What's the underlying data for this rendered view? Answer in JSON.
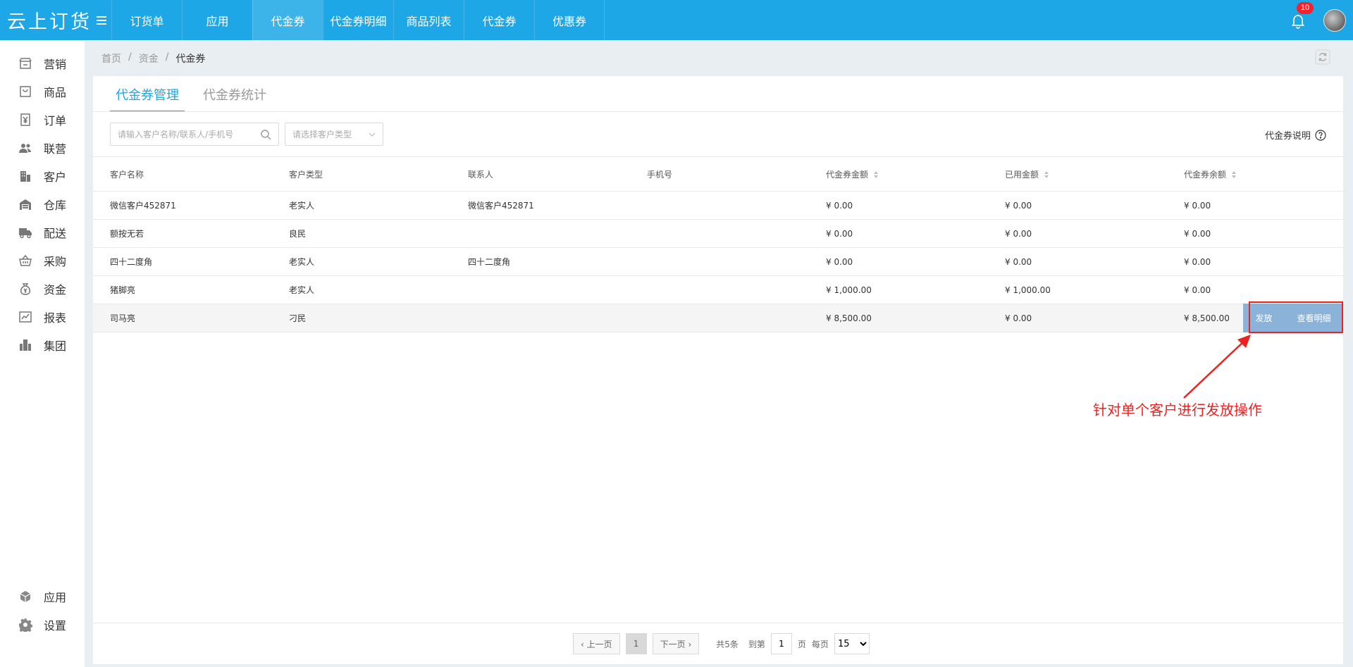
{
  "app": {
    "logo": "云上订货",
    "notification_count": "10"
  },
  "topnav": [
    {
      "label": "订货单",
      "active": false
    },
    {
      "label": "应用",
      "active": false
    },
    {
      "label": "代金券",
      "active": true
    },
    {
      "label": "代金券明细",
      "active": false
    },
    {
      "label": "商品列表",
      "active": false
    },
    {
      "label": "代金券",
      "active": false
    },
    {
      "label": "优惠券",
      "active": false
    }
  ],
  "sidebar": {
    "items": [
      {
        "label": "营销",
        "icon": "store-icon"
      },
      {
        "label": "商品",
        "icon": "shopping-bag-icon"
      },
      {
        "label": "订单",
        "icon": "yen-document-icon"
      },
      {
        "label": "联营",
        "icon": "users-icon"
      },
      {
        "label": "客户",
        "icon": "building-icon"
      },
      {
        "label": "仓库",
        "icon": "warehouse-icon"
      },
      {
        "label": "配送",
        "icon": "truck-icon"
      },
      {
        "label": "采购",
        "icon": "basket-icon"
      },
      {
        "label": "资金",
        "icon": "money-bag-icon"
      },
      {
        "label": "报表",
        "icon": "chart-icon"
      },
      {
        "label": "集团",
        "icon": "group-building-icon"
      }
    ],
    "bottom": [
      {
        "label": "应用",
        "icon": "cube-icon"
      },
      {
        "label": "设置",
        "icon": "gear-icon"
      }
    ]
  },
  "breadcrumb": {
    "home": "首页",
    "sep": "/",
    "parent": "资金",
    "current": "代金券"
  },
  "tabs": [
    {
      "label": "代金券管理",
      "active": true
    },
    {
      "label": "代金券统计",
      "active": false
    }
  ],
  "filters": {
    "search_placeholder": "请输入客户名称/联系人/手机号",
    "type_placeholder": "请选择客户类型",
    "help_label": "代金券说明"
  },
  "table": {
    "headers": [
      "客户名称",
      "客户类型",
      "联系人",
      "手机号",
      "代金券金额",
      "已用金额",
      "代金券余额"
    ],
    "rows": [
      {
        "name": "微信客户452871",
        "type": "老实人",
        "contact": "微信客户452871",
        "phone": "",
        "amount": "¥ 0.00",
        "used": "¥ 0.00",
        "balance": "¥ 0.00"
      },
      {
        "name": "额按无若",
        "type": "良民",
        "contact": "",
        "phone": "",
        "amount": "¥ 0.00",
        "used": "¥ 0.00",
        "balance": "¥ 0.00"
      },
      {
        "name": "四十二度角",
        "type": "老实人",
        "contact": "四十二度角",
        "phone": "",
        "amount": "¥ 0.00",
        "used": "¥ 0.00",
        "balance": "¥ 0.00"
      },
      {
        "name": "猪脚亮",
        "type": "老实人",
        "contact": "",
        "phone": "",
        "amount": "¥ 1,000.00",
        "used": "¥ 1,000.00",
        "balance": "¥ 0.00"
      },
      {
        "name": "司马亮",
        "type": "刁民",
        "contact": "",
        "phone": "",
        "amount": "¥ 8,500.00",
        "used": "¥ 0.00",
        "balance": "¥ 8,500.00"
      }
    ],
    "actions": {
      "issue": "发放",
      "detail": "查看明细"
    }
  },
  "annotation": "针对单个客户进行发放操作",
  "pager": {
    "prev": "‹ 上一页",
    "current_page": "1",
    "next": "下一页 ›",
    "total": "共5条",
    "goto": "到第",
    "page_unit": "页",
    "per_page": "每页",
    "page_size": "15"
  },
  "colors": {
    "brand": "#1ea7e6",
    "nav_active": "#3cb4ea",
    "badge": "#f5222d",
    "action_bg": "#8bb3da",
    "annotation": "#f02020"
  }
}
